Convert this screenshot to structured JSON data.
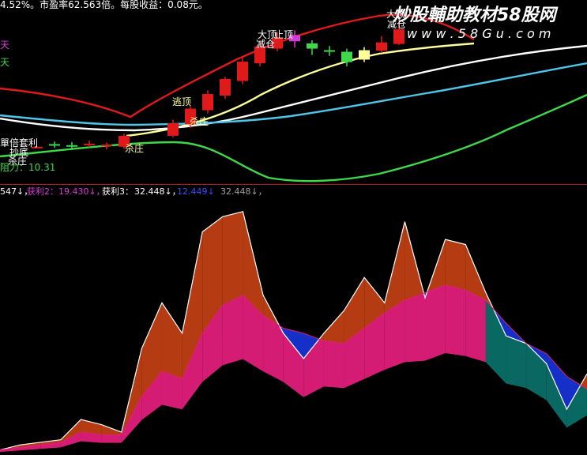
{
  "colors": {
    "bg": "#000000",
    "red": "#e01a1a",
    "yellow": "#fffe9a",
    "white": "#ffffff",
    "cyan": "#4fc6e8",
    "green": "#3fd84a",
    "divider": "#b81b1b",
    "brown": "#b53b12",
    "magenta": "#e01e7a",
    "blue": "#1430c8",
    "teal": "#0a6e66",
    "label_white": "#ffffff",
    "label_magenta": "#d63bd6",
    "label_blue": "#3850ff",
    "label_gray": "#a0a0a0"
  },
  "header": {
    "text": "4.52%。市盈率62.563倍。每股收益：0.08元。"
  },
  "watermark": {
    "text": "炒股輔助教材58股网",
    "url": "w w w . 5 8 G u . c o m"
  },
  "left_labels": {
    "tian1": "天",
    "tian2": "天",
    "ability": "阻力：10.31",
    "junk": "單倍套利",
    "shajuan": "抄底",
    "shazhuang": "杀庄"
  },
  "panel2_legend": {
    "v0": "547↓，",
    "k2_label": "获利2：",
    "k2_val": "19.430↓，",
    "k3_label": "获利3：",
    "k3_val": "32.448↓，",
    "k4_val": "12.449↓",
    "k5_val": "32.448↓，"
  },
  "candle_labels": [
    {
      "text": "大顶",
      "anchor": "upper-1"
    },
    {
      "text": "减仓",
      "anchor": "upper-1b"
    },
    {
      "text": "止顶",
      "anchor": "upper-2"
    },
    {
      "text": "大顶",
      "anchor": "upper-3"
    },
    {
      "text": "减仓",
      "anchor": "upper-3b"
    },
    {
      "text": "逃顶",
      "anchor": "mid-1"
    },
    {
      "text": "杀庄",
      "anchor": "mid-2"
    },
    {
      "text": "杀庄",
      "anchor": "low-1"
    }
  ],
  "chart_data": [
    {
      "type": "candlestick",
      "title": "",
      "candles": [
        {
          "x": 0,
          "o": 212,
          "c": 212,
          "h": 212,
          "l": 212
        },
        {
          "x": 1,
          "o": 212.5,
          "c": 212.2,
          "h": 213,
          "l": 211.8
        },
        {
          "x": 2,
          "o": 212.3,
          "c": 212.1,
          "h": 212.9,
          "l": 211.6
        },
        {
          "x": 3,
          "o": 212.3,
          "c": 212.6,
          "h": 213.2,
          "l": 211.9
        },
        {
          "x": 4,
          "o": 212.2,
          "c": 212.4,
          "h": 212.8,
          "l": 211.5
        },
        {
          "x": 5,
          "o": 212.0,
          "c": 214.1,
          "h": 214.5,
          "l": 211.6
        },
        {
          "x": 6,
          "o": 214.1,
          "c": 216.5,
          "h": 217.2,
          "l": 213.8
        },
        {
          "x": 7,
          "o": 216.3,
          "c": 219.3,
          "h": 219.8,
          "l": 215.6
        },
        {
          "x": 8,
          "o": 219.0,
          "c": 222.1,
          "h": 222.8,
          "l": 218.4
        },
        {
          "x": 9,
          "o": 221.8,
          "c": 225.0,
          "h": 225.4,
          "l": 221.2
        },
        {
          "x": 10,
          "o": 224.6,
          "c": 228.3,
          "h": 229.1,
          "l": 224.0
        },
        {
          "x": 11,
          "o": 228.0,
          "c": 231.2,
          "h": 232.2,
          "l": 227.4
        },
        {
          "x": 12,
          "o": 230.8,
          "c": 232.8,
          "h": 234.0,
          "l": 230.3
        },
        {
          "x": 13,
          "o": 233.4,
          "c": 232.2,
          "h": 234.3,
          "l": 231.0
        },
        {
          "x": 14,
          "o": 231.8,
          "c": 230.8,
          "h": 232.4,
          "l": 229.6
        },
        {
          "x": 15,
          "o": 230.5,
          "c": 230.2,
          "h": 231.3,
          "l": 229.4
        },
        {
          "x": 16,
          "o": 230.2,
          "c": 228.2,
          "h": 230.8,
          "l": 227.4
        },
        {
          "x": 17,
          "o": 228.7,
          "c": 230.5,
          "h": 231.1,
          "l": 228.2
        },
        {
          "x": 18,
          "o": 230.4,
          "c": 232.0,
          "h": 233.2,
          "l": 230.0
        },
        {
          "x": 19,
          "o": 231.7,
          "c": 234.5,
          "h": 236.0,
          "l": 231.5
        }
      ],
      "ma_lines": [
        "red",
        "yellow",
        "white",
        "cyan",
        "green"
      ],
      "ylim": [
        205,
        238
      ]
    },
    {
      "type": "area",
      "title": "",
      "series": [
        {
          "name": "获利2",
          "values": [
            2,
            4,
            5,
            6,
            14,
            12,
            9,
            42,
            60,
            48,
            88,
            94,
            96,
            63,
            48,
            38,
            48,
            57,
            70,
            60,
            92,
            62,
            85,
            83,
            64,
            47,
            44,
            36,
            18,
            32
          ]
        },
        {
          "name": "获利3",
          "values": [
            2,
            3,
            4,
            5,
            9,
            8,
            8,
            23,
            33,
            30,
            48,
            59,
            63,
            55,
            50,
            48,
            45,
            44,
            50,
            56,
            61,
            64,
            67,
            65,
            61,
            52,
            44,
            40,
            31,
            26
          ]
        },
        {
          "name": "series-white",
          "values": [
            2,
            4,
            5,
            6,
            14,
            12,
            9,
            42,
            60,
            48,
            88,
            94,
            96,
            63,
            48,
            38,
            48,
            57,
            70,
            60,
            92,
            62,
            85,
            83,
            64,
            47,
            44,
            36,
            18,
            32
          ]
        },
        {
          "name": "series-blue",
          "values": [
            2,
            3,
            4,
            5,
            9,
            8,
            8,
            23,
            33,
            30,
            48,
            59,
            63,
            55,
            50,
            48,
            45,
            44,
            50,
            56,
            61,
            64,
            67,
            65,
            61,
            52,
            44,
            40,
            31,
            26
          ]
        }
      ],
      "ylim": [
        0,
        100
      ]
    }
  ]
}
